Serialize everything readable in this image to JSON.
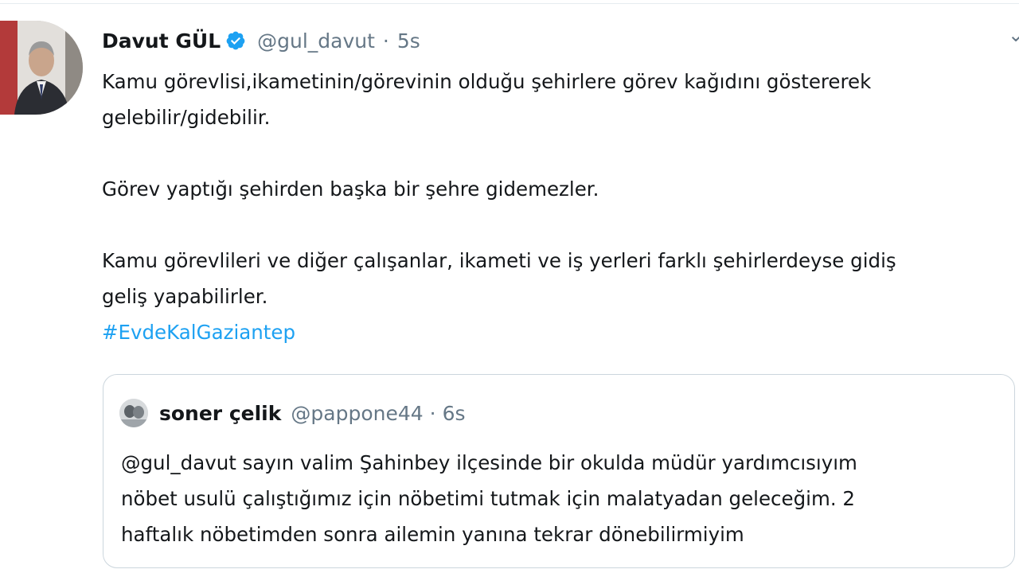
{
  "tweet": {
    "author_name": "Davut GÜL",
    "verified": true,
    "handle": "@gul_davut",
    "separator": "·",
    "time": "5s",
    "line1": "Kamu görevlisi,ikametinin/görevinin olduğu şehirlere görev kağıdını göstererek",
    "line2": "gelebilir/gidebilir.",
    "line3": "Görev yaptığı şehirden başka bir şehre gidemezler.",
    "line4": "Kamu görevlileri ve diğer çalışanlar, ikameti ve iş yerleri farklı şehirlerdeyse gidiş",
    "line5": "geliş yapabilirler.",
    "hashtag": "#EvdeKalGaziantep"
  },
  "quoted_tweet": {
    "author_name": "soner çelik",
    "handle": "@pappone44",
    "separator": "·",
    "time": "6s",
    "line1": "@gul_davut sayın valim Şahinbey ilçesinde bir okulda müdür yardımcısıyım",
    "line2": "nöbet usulü çalıştığımız için nöbetimi tutmak için malatyadan geleceğim. 2",
    "line3": "haftalık nöbetimden sonra ailemin yanına tekrar dönebilirmiyim"
  },
  "colors": {
    "text": "#14171a",
    "secondary": "#657786",
    "link": "#1da1f2",
    "border": "#ccd6dd"
  },
  "icons": {
    "verified": "verified-badge-icon",
    "more": "more-icon"
  }
}
